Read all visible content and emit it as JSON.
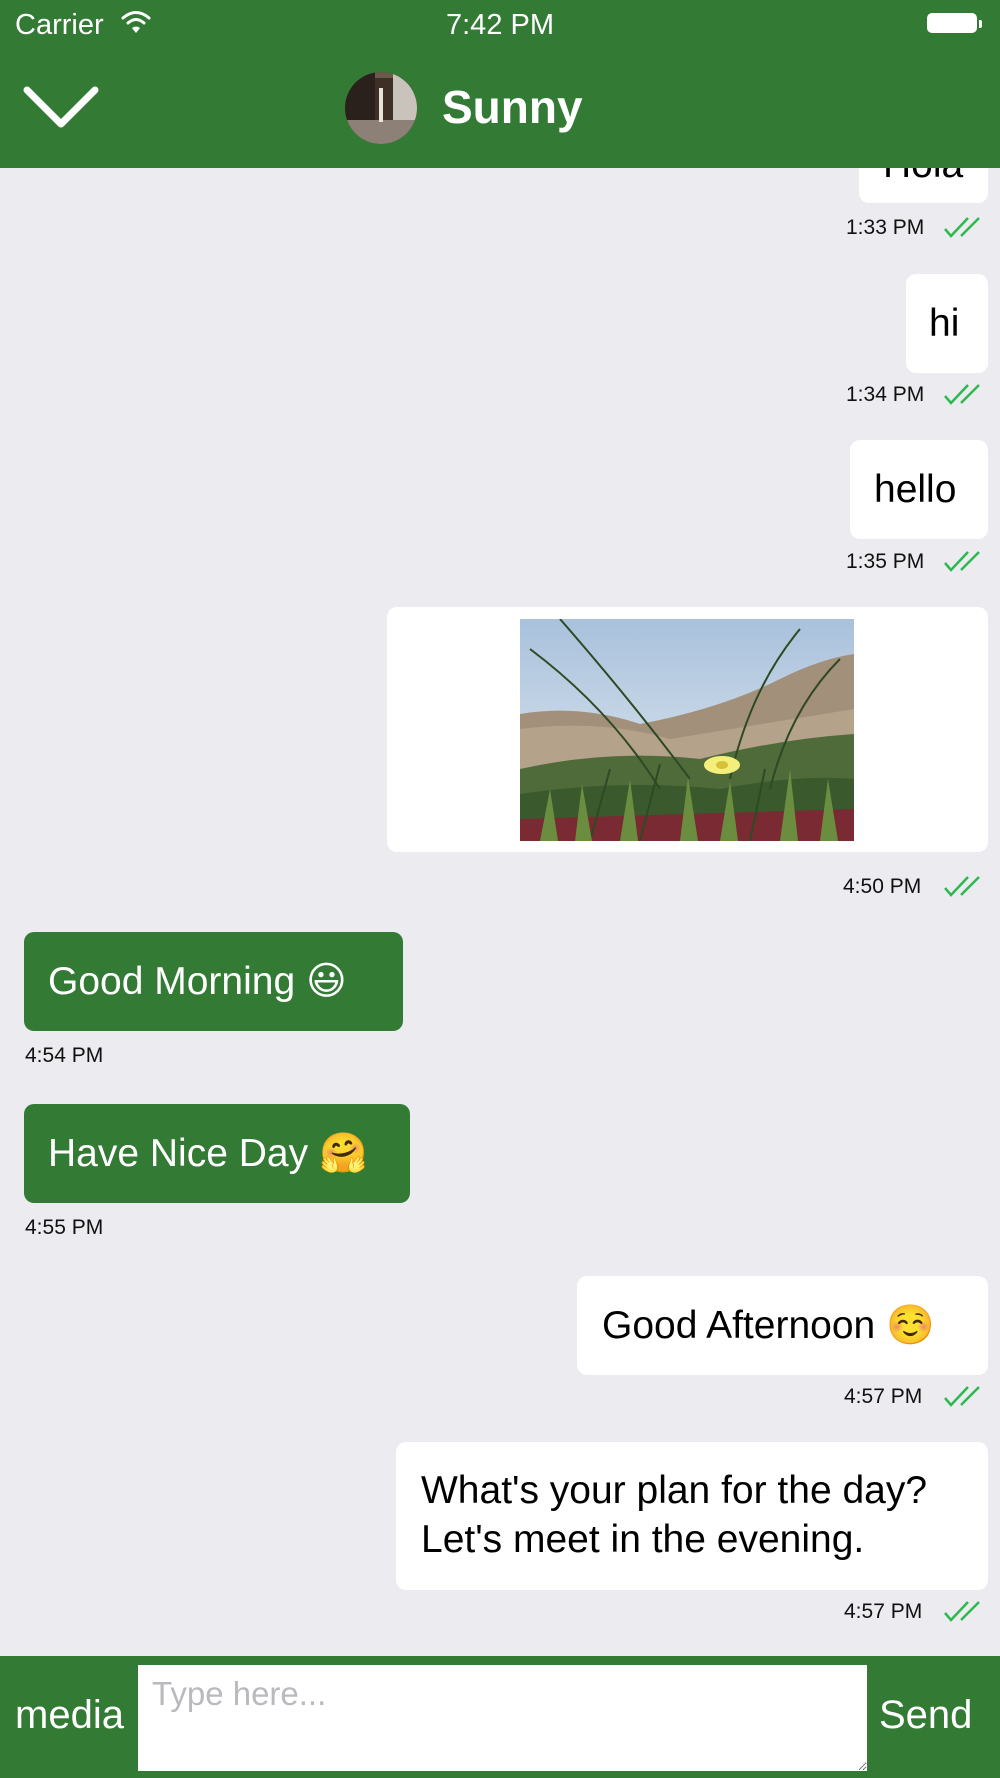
{
  "status_bar": {
    "carrier": "Carrier",
    "time": "7:42 PM"
  },
  "header": {
    "contact_name": "Sunny",
    "back_icon": "chevron-down-icon",
    "avatar_icon": "contact-avatar"
  },
  "colors": {
    "theme_green": "#337a35",
    "outgoing_bubble": "#ffffff",
    "chat_background": "#ebebf0",
    "read_ticks": "#2eb84f"
  },
  "messages": [
    {
      "direction": "outgoing",
      "text": "Hola",
      "time": "1:33 PM",
      "status": "read"
    },
    {
      "direction": "outgoing",
      "text": "hi",
      "time": "1:34 PM",
      "status": "read"
    },
    {
      "direction": "outgoing",
      "text": "hello",
      "time": "1:35 PM",
      "status": "read"
    },
    {
      "direction": "outgoing",
      "type": "image",
      "image": "photo-of-beach-dune-flower",
      "time": "4:50 PM",
      "status": "read"
    },
    {
      "direction": "incoming",
      "text": "Good Morning",
      "emoji": "😃",
      "time": "4:54 PM"
    },
    {
      "direction": "incoming",
      "text": "Have Nice Day",
      "emoji": "🤗",
      "time": "4:55 PM"
    },
    {
      "direction": "outgoing",
      "text": "Good Afternoon",
      "emoji": "☺️",
      "time": "4:57 PM",
      "status": "read"
    },
    {
      "direction": "outgoing",
      "lines": [
        "What's your plan for the day?",
        "Let's meet in the evening."
      ],
      "time": "4:57 PM",
      "status": "read"
    }
  ],
  "composer": {
    "media_label": "media",
    "placeholder": "Type here...",
    "value": "",
    "send_label": "Send"
  }
}
